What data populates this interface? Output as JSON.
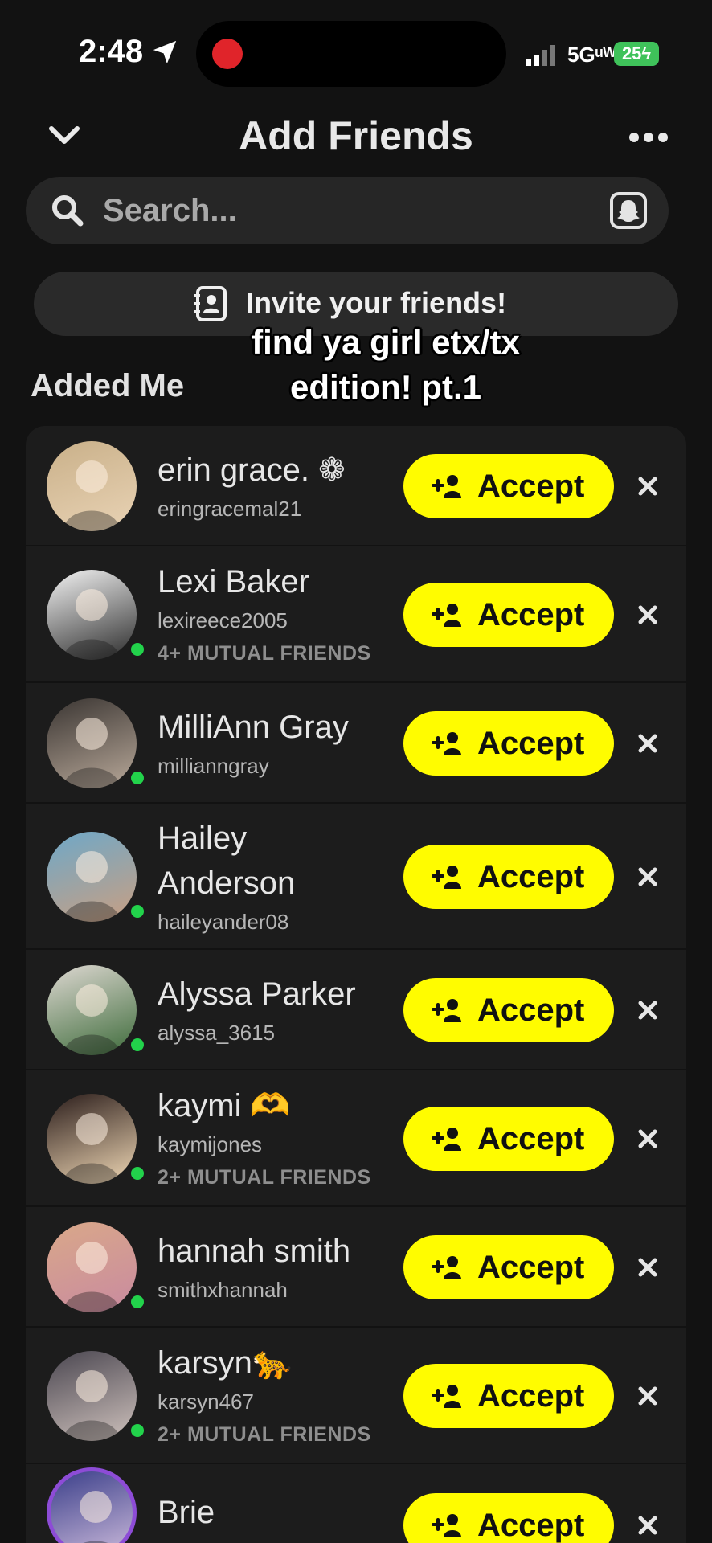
{
  "status_bar": {
    "time": "2:48",
    "network": "5Gᵘᵂ",
    "battery": "25ϟ"
  },
  "header": {
    "title": "Add Friends"
  },
  "search": {
    "placeholder": "Search..."
  },
  "invite": {
    "label": "Invite your friends!"
  },
  "caption": {
    "line1": "find ya girl etx/tx",
    "line2": "edition! pt.1"
  },
  "section": {
    "title": "Added Me"
  },
  "accept_label": "Accept",
  "friends": [
    {
      "name": "erin grace. ❁",
      "username": "eringracemal21",
      "mutual": "",
      "online": false,
      "colors": [
        "#c9b089",
        "#e9d3b5"
      ]
    },
    {
      "name": "Lexi Baker",
      "username": "lexireece2005",
      "mutual": "4+ MUTUAL FRIENDS",
      "online": true,
      "colors": [
        "#f4f4f4",
        "#2a2a2a"
      ]
    },
    {
      "name": "MilliAnn Gray",
      "username": "millianngray",
      "mutual": "",
      "online": true,
      "colors": [
        "#3a3532",
        "#b9a99a"
      ]
    },
    {
      "name": "Hailey Anderson",
      "username": "haileyander08",
      "mutual": "",
      "online": true,
      "colors": [
        "#6ea8c8",
        "#c99f82"
      ]
    },
    {
      "name": "Alyssa Parker",
      "username": "alyssa_3615",
      "mutual": "",
      "online": true,
      "colors": [
        "#ded8d2",
        "#3d6b3a"
      ]
    },
    {
      "name": "kaymi 🫶",
      "username": "kaymijones",
      "mutual": "2+ MUTUAL FRIENDS",
      "online": true,
      "colors": [
        "#2a1c1a",
        "#f1d9b6"
      ]
    },
    {
      "name": "hannah smith",
      "username": "smithxhannah",
      "mutual": "",
      "online": true,
      "colors": [
        "#d9a889",
        "#c98aa0"
      ]
    },
    {
      "name": "karsyn🐆",
      "username": "karsyn467",
      "mutual": "2+ MUTUAL FRIENDS",
      "online": true,
      "colors": [
        "#4a4650",
        "#cfc2bd"
      ]
    },
    {
      "name": "Brie",
      "username": "",
      "mutual": "",
      "online": false,
      "colors": [
        "#3b3f8a",
        "#c8b7d9"
      ]
    }
  ]
}
